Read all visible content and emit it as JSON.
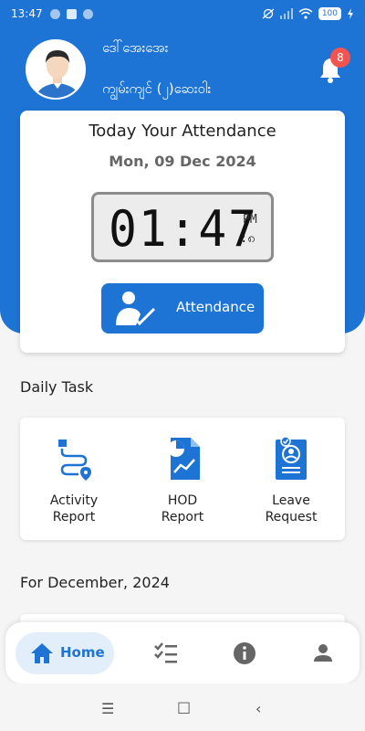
{
  "status_bar": {
    "time": "13:47",
    "battery": "100"
  },
  "header": {
    "user_name": "ဒေါ်အေးအေး",
    "department": "ကျွမ်းကျင် (၂)ဆေးဝါး",
    "notification_count": "8"
  },
  "attendance": {
    "title": "Today Your Attendance",
    "date": "Mon, 09 Dec 2024",
    "clock_time": "01:47",
    "clock_ampm": "PM",
    "clock_seconds": ":၈",
    "button_label": "Attendance"
  },
  "daily_task": {
    "title": "Daily Task",
    "items": [
      {
        "label_line1": "Activity",
        "label_line2": "Report",
        "icon": "activity-report-icon"
      },
      {
        "label_line1": "HOD",
        "label_line2": "Report",
        "icon": "hod-report-icon"
      },
      {
        "label_line1": "Leave",
        "label_line2": "Request",
        "icon": "leave-request-icon"
      }
    ]
  },
  "month_section": {
    "title": "For  December,  2024"
  },
  "bottom_nav": {
    "home_label": "Home",
    "items": [
      "home-icon",
      "tasks-icon",
      "info-icon",
      "profile-icon"
    ]
  },
  "colors": {
    "primary": "#1e74d4",
    "badge": "#f25550",
    "background": "#f5f5f5"
  }
}
